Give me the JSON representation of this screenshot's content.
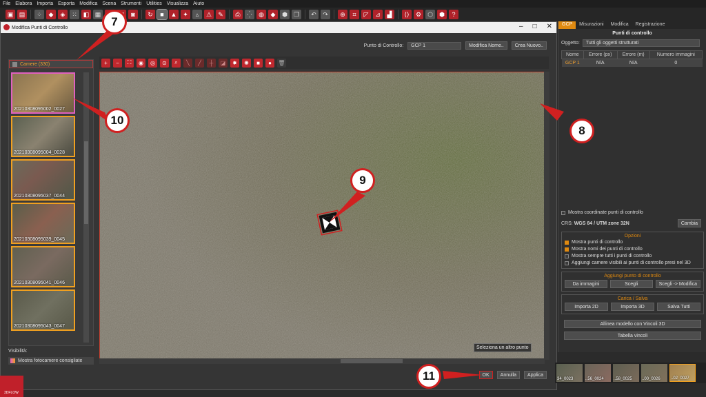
{
  "menu": [
    "File",
    "Elabora",
    "Importa",
    "Esporta",
    "Modifica",
    "Scena",
    "Strumenti",
    "Utilities",
    "Visualizza",
    "Aiuto"
  ],
  "dialog": {
    "title": "Modifica Punti di Controllo",
    "control_point_label": "Punto di Controllo:",
    "control_point_value": "GCP 1",
    "rename_button": "Modifica Nome..",
    "create_button": "Crea Nuovo..",
    "cameras_header": "Camere (330)",
    "thumbnails": [
      "20210308095002_0027",
      "20210308095004_0028",
      "20210308095037_0044",
      "20210308095039_0045",
      "20210308095041_0046",
      "20210308095043_0047"
    ],
    "visibility_label": "Visibilità:",
    "visibility_option": "Mostra fotocamere consigliate",
    "select_other": "Seleziona un altro punto",
    "ok": "OK",
    "cancel": "Annulla",
    "apply": "Applica"
  },
  "right_panel": {
    "tabs": [
      "GCP",
      "Misurazioni",
      "Modifica",
      "Registrazione"
    ],
    "title": "Punti di controllo",
    "object_label": "Oggetto:",
    "object_value": "Tutti gli oggetti strutturati",
    "columns": [
      "Nome",
      "Errore (px)",
      "Errore (m)",
      "Numero immagini"
    ],
    "rows": [
      [
        "GCP 1",
        "N/A",
        "N/A",
        "0"
      ]
    ],
    "show_coords": "Mostra coordinate punti di controllo",
    "crs_label": "CRS:",
    "crs_value": "WGS 84 / UTM zone 32N",
    "change_button": "Cambia",
    "options_title": "Opzioni",
    "options": [
      {
        "label": "Mostra punti di controllo",
        "checked": true
      },
      {
        "label": "Mostra nomi dei punti di controllo",
        "checked": true
      },
      {
        "label": "Mostra sempre tutti i punti di controllo",
        "checked": false
      },
      {
        "label": "Aggiungi camere visibili ai punti di controllo presi nel 3D",
        "checked": false
      }
    ],
    "add_title": "Aggiungi punto di controllo",
    "add_buttons": [
      "Da immagini",
      "Scegli",
      "Scegli -> Modifica"
    ],
    "load_title": "Carica / Salva",
    "load_buttons": [
      "Importa 2D",
      "Importa 3D",
      "Salva Tutti"
    ],
    "align_button": "Allinea modello con Vincoli 3D",
    "table_button": "Tabella vincoli"
  },
  "bottom_strip": [
    "34_0023",
    "..56_0024",
    "..58_0025",
    "..00_0026",
    "..02_0027"
  ],
  "brand": "3DFLOW",
  "callouts": [
    "7",
    "8",
    "9",
    "10",
    "11"
  ],
  "colors": {
    "accent": "#e08a10",
    "brand_red": "#c0202a",
    "callout_border": "#d02020"
  }
}
